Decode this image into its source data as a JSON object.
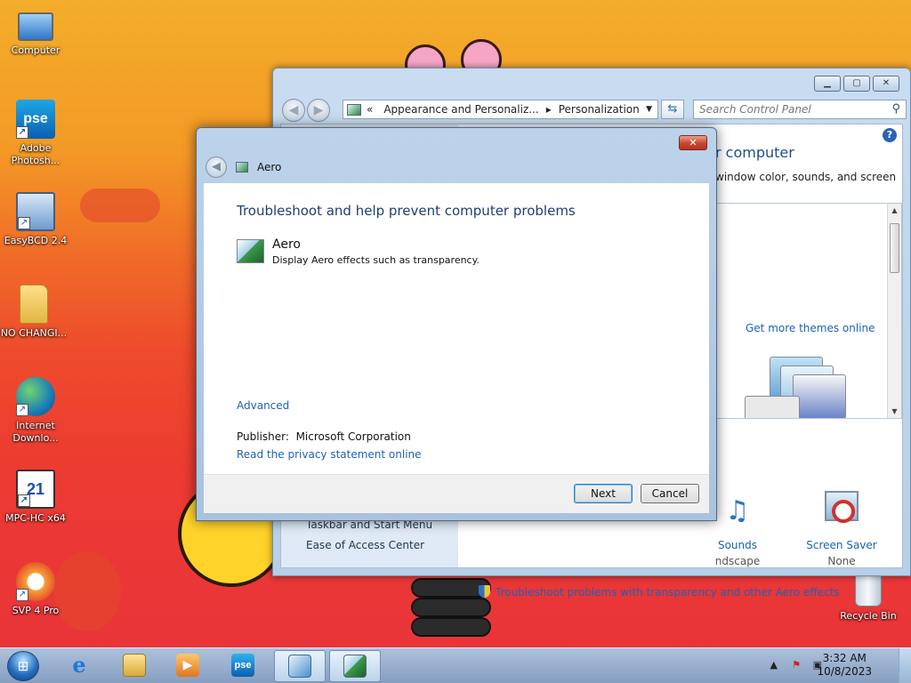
{
  "desktop": {
    "icons": [
      {
        "label": "Computer",
        "icon": "computer-icon"
      },
      {
        "label": "Adobe Photosh...",
        "icon": "photoshop-elements-icon",
        "glyph": "pse"
      },
      {
        "label": "EasyBCD 2.4",
        "icon": "easybcd-icon"
      },
      {
        "label": "NO CHANGI...",
        "icon": "folder-icon"
      },
      {
        "label": "Internet Downlo...",
        "icon": "internet-download-manager-icon"
      },
      {
        "label": "MPC-HC x64",
        "icon": "mpc-hc-icon",
        "glyph": "21"
      },
      {
        "label": "SVP 4 Pro",
        "icon": "svp-icon"
      },
      {
        "label": "Recycle Bin",
        "icon": "recycle-bin-icon"
      }
    ]
  },
  "control_panel": {
    "breadcrumb_prefix": "«",
    "breadcrumb_1": "Appearance and Personaliz...",
    "breadcrumb_sep": "▸",
    "breadcrumb_2": "Personalization",
    "search_placeholder": "Search Control Panel",
    "heading_fragment": "r computer",
    "subtext_fragment": "window color, sounds, and screen",
    "more_themes_link": "Get more themes online",
    "sidebar_items": [
      "Taskbar and Start Menu",
      "Ease of Access Center"
    ],
    "bottom_options": [
      {
        "label": "Sounds",
        "value": "ndscape",
        "icon": "sounds-icon"
      },
      {
        "label": "Screen Saver",
        "value": "None",
        "icon": "screen-saver-icon"
      }
    ],
    "troubleshoot_link": "Troubleshoot problems with transparency and other Aero effects"
  },
  "dialog": {
    "title": "Aero",
    "heading": "Troubleshoot and help prevent computer problems",
    "package_name": "Aero",
    "package_description": "Display Aero effects such as transparency.",
    "advanced_link": "Advanced",
    "publisher_label": "Publisher:",
    "publisher_value": "Microsoft Corporation",
    "privacy_link": "Read the privacy statement online",
    "next_label": "Next",
    "cancel_label": "Cancel"
  },
  "taskbar": {
    "time": "3:32 AM",
    "date": "10/8/2023",
    "pinned": [
      {
        "name": "internet-explorer",
        "glyph": "e"
      },
      {
        "name": "file-explorer",
        "glyph": ""
      },
      {
        "name": "media-player",
        "glyph": "▶"
      },
      {
        "name": "photoshop-elements",
        "glyph": "pse"
      },
      {
        "name": "control-panel",
        "glyph": ""
      },
      {
        "name": "troubleshooter",
        "glyph": ""
      }
    ]
  },
  "colors": {
    "link": "#1b62b7",
    "heading": "#1d3f72",
    "close_button": "#c8462f"
  }
}
